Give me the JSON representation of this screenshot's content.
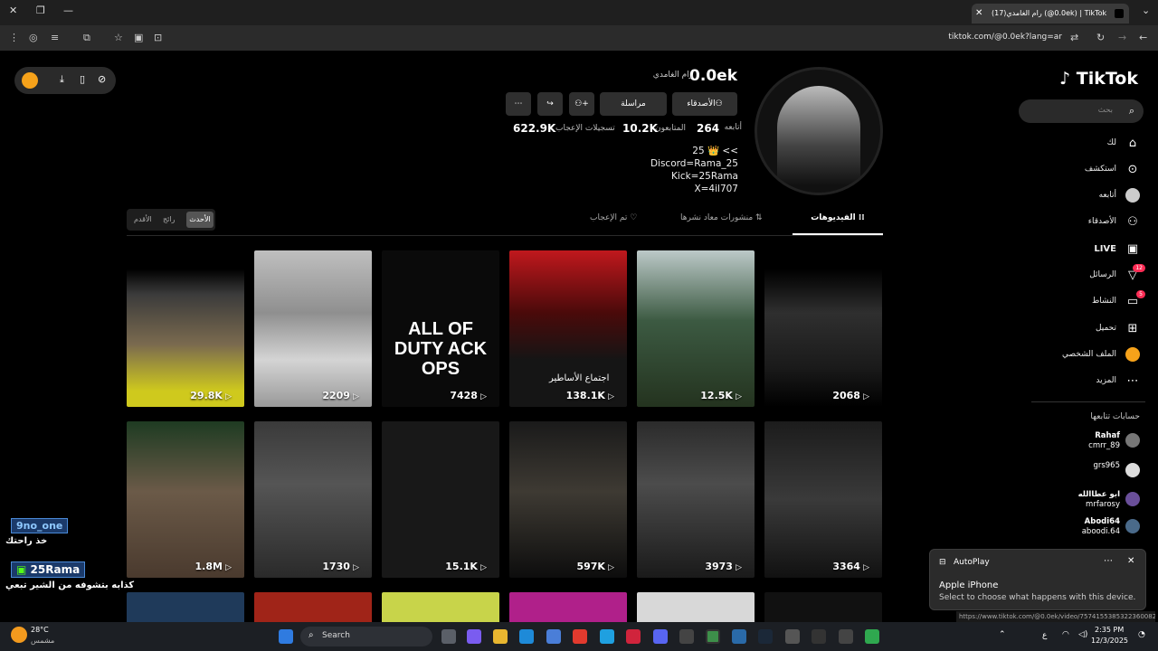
{
  "browser": {
    "tab_title": "(17)رام الغامدي (@0.0ek) | TikTok",
    "url": "tiktok.com/@0.0ek?lang=ar",
    "status_url": "https://www.tiktok.com/@0.0ek/video/7574155385322360082"
  },
  "sidebar": {
    "logo": "TikTok",
    "search_placeholder": "بحث",
    "items": [
      {
        "label": "لك",
        "icon": "home-icon"
      },
      {
        "label": "استكشف",
        "icon": "compass-icon"
      },
      {
        "label": "أتابعه",
        "icon": "following-avatar-icon"
      },
      {
        "label": "الأصدقاء",
        "icon": "friends-icon"
      },
      {
        "label": "LIVE",
        "icon": "live-icon"
      },
      {
        "label": "الرسائل",
        "icon": "messages-icon",
        "badge": "12"
      },
      {
        "label": "النشاط",
        "icon": "activity-icon",
        "badge": "5"
      },
      {
        "label": "تحميل",
        "icon": "upload-icon"
      },
      {
        "label": "الملف الشخصي",
        "icon": "profile-avatar-icon"
      },
      {
        "label": "المزيد",
        "icon": "more-icon"
      }
    ],
    "following_title": "حسابات تتابعها",
    "following": [
      {
        "name": "Rahaf",
        "handle": "cmrr_89"
      },
      {
        "name": "",
        "handle": "grs965"
      },
      {
        "name": "ابو عطاالله",
        "handle": "mrfarosy"
      },
      {
        "name": "Abodi64",
        "handle": "aboodi.64"
      }
    ]
  },
  "profile": {
    "username": "0.0ek",
    "display_name": "رام الغامدي",
    "btn_friends": "الأصدقاء",
    "btn_message": "مراسلة",
    "following_count": "264",
    "following_label": "أتابعه",
    "followers_count": "10.2K",
    "followers_label": "المتابعون",
    "likes_count": "622.9K",
    "likes_label": "تسجيلات الإعجاب",
    "bio": [
      "25 👑 <<",
      "Discord=Rama_25",
      "Kick=25Rama",
      "X=4il707"
    ]
  },
  "tabs": {
    "videos": "الفيديوهات",
    "reposts": "منشورات معاد نشرها",
    "liked": "تم الإعجاب",
    "sort_latest": "الأحدث",
    "sort_popular": "رائج",
    "sort_oldest": "الأقدم"
  },
  "videos": [
    {
      "views": "2068",
      "overlay": ""
    },
    {
      "views": "12.5K",
      "overlay": ""
    },
    {
      "views": "138.1K",
      "overlay": "اجتماع الأساطير"
    },
    {
      "views": "7428",
      "overlay": "ALL OF DUTY ACK OPS"
    },
    {
      "views": "2209",
      "overlay": ""
    },
    {
      "views": "29.8K",
      "overlay": ""
    },
    {
      "views": "3364",
      "overlay": ""
    },
    {
      "views": "3973",
      "overlay": ""
    },
    {
      "views": "597K",
      "overlay": ""
    },
    {
      "views": "15.1K",
      "overlay": ""
    },
    {
      "views": "1730",
      "overlay": ""
    },
    {
      "views": "1.8M",
      "overlay": ""
    }
  ],
  "stream_overlay": {
    "user1": "9no_one",
    "msg1": "خذ راحتك",
    "user2": "25Rama",
    "msg2": "كذابه بتشوفه من الشير تبعي"
  },
  "autoplay": {
    "title": "AutoPlay",
    "heading": "Apple iPhone",
    "body": "Select to choose what happens with this device."
  },
  "taskbar": {
    "weather_temp": "28°C",
    "weather_desc": "مشمس",
    "search_label": "Search",
    "time": "2:35 PM",
    "date": "12/3/2025",
    "lang": "ع"
  }
}
